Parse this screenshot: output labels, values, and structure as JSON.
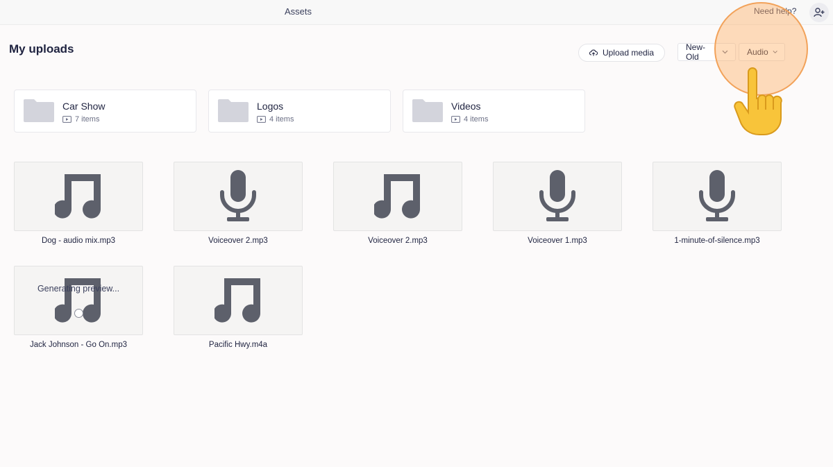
{
  "header": {
    "title": "Assets",
    "help_label": "Need help?",
    "invite_icon": "user-plus-icon"
  },
  "page": {
    "title": "My uploads"
  },
  "toolbar": {
    "upload_label": "Upload media",
    "sort_value": "New-Old",
    "filter_value": "Audio"
  },
  "folders": [
    {
      "name": "Car Show",
      "count": "7 items"
    },
    {
      "name": "Logos",
      "count": "4 items"
    },
    {
      "name": "Videos",
      "count": "4 items"
    }
  ],
  "assets": [
    {
      "name": "Dog - audio mix.mp3",
      "icon": "music-note-icon"
    },
    {
      "name": "Voiceover 2.mp3",
      "icon": "microphone-icon"
    },
    {
      "name": "Voiceover 2.mp3",
      "icon": "music-note-icon"
    },
    {
      "name": "Voiceover 1.mp3",
      "icon": "microphone-icon"
    },
    {
      "name": "1-minute-of-silence.mp3",
      "icon": "microphone-icon"
    },
    {
      "name": "Jack Johnson - Go On.mp3",
      "icon": "music-note-icon",
      "status": "Generating preview..."
    },
    {
      "name": "Pacific Hwy.m4a",
      "icon": "music-note-icon"
    }
  ],
  "colors": {
    "icon_gray": "#5d606b",
    "folder_gray": "#d3d4dc",
    "highlight": "#f2a25a"
  }
}
